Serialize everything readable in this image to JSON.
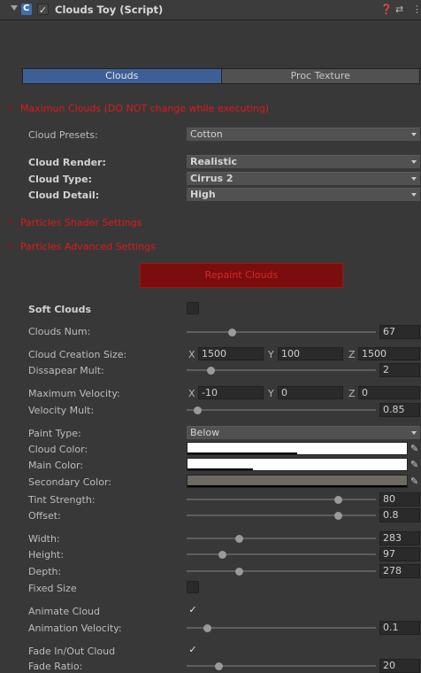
{
  "header": {
    "title": "Clouds Toy (Script)",
    "enabled_check": "✓",
    "help_icon": "help-icon",
    "settings_icon": "sliders-icon",
    "menu_icon": "more-vert-icon"
  },
  "tabs": [
    {
      "label": "Clouds",
      "active": true
    },
    {
      "label": "Proc Texture",
      "active": false
    }
  ],
  "sections": {
    "max_clouds": "Maximun Clouds (DO NOT change while executing)",
    "particles_shader": "Particles Shader Settings",
    "particles_advanced": "Particles Advanced Settings"
  },
  "fields": {
    "cloud_presets": {
      "label": "Cloud Presets:",
      "value": "Cotton"
    },
    "cloud_render": {
      "label": "Cloud Render:",
      "value": "Realistic"
    },
    "cloud_type": {
      "label": "Cloud Type:",
      "value": "Cirrus 2"
    },
    "cloud_detail": {
      "label": "Cloud Detail:",
      "value": "High"
    },
    "repaint": "Repaint Clouds",
    "soft_clouds": {
      "label": "Soft Clouds",
      "checked": false
    },
    "clouds_num": {
      "label": "Clouds Num:",
      "value": "67",
      "fraction": 0.24
    },
    "cloud_creation_size": {
      "label": "Cloud Creation Size:",
      "x": "1500",
      "y": "100",
      "z": "1500"
    },
    "dissapear_mult": {
      "label": "Dissapear Mult:",
      "value": "2",
      "fraction": 0.13
    },
    "maximum_velocity": {
      "label": "Maximum Velocity:",
      "x": "-10",
      "y": "0",
      "z": "0"
    },
    "velocity_mult": {
      "label": "Velocity Mult:",
      "value": "0.85",
      "fraction": 0.06
    },
    "paint_type": {
      "label": "Paint Type:",
      "value": "Below"
    },
    "cloud_color": {
      "label": "Cloud Color:",
      "color": "#ffffff",
      "alpha": 0.5
    },
    "main_color": {
      "label": "Main Color:",
      "color": "#ffffff",
      "alpha": 0.3
    },
    "secondary_color": {
      "label": "Secondary Color:",
      "color": "#6e6a62",
      "alpha": 1.0
    },
    "tint_strength": {
      "label": "Tint Strength:",
      "value": "80",
      "fraction": 0.8
    },
    "offset": {
      "label": "Offset:",
      "value": "0.8",
      "fraction": 0.8
    },
    "width": {
      "label": "Width:",
      "value": "283",
      "fraction": 0.28
    },
    "height": {
      "label": "Height:",
      "value": "97",
      "fraction": 0.19
    },
    "depth": {
      "label": "Depth:",
      "value": "278",
      "fraction": 0.28
    },
    "fixed_size": {
      "label": "Fixed Size",
      "checked": false
    },
    "animate_cloud": {
      "label": "Animate Cloud",
      "checked": true,
      "mark": "✓"
    },
    "animation_velocity": {
      "label": "Animation Velocity:",
      "value": "0.1",
      "fraction": 0.11
    },
    "fade_cloud": {
      "label": "Fade In/Out Cloud",
      "checked": true,
      "mark": "✓"
    },
    "fade_ratio": {
      "label": "Fade Ratio:",
      "value": "20",
      "fraction": 0.17
    }
  },
  "axis": {
    "x": "X",
    "y": "Y",
    "z": "Z"
  },
  "colors": {
    "accent_tab": "#3e5f96",
    "warning_red": "#e21919",
    "repaint_bg": "#7a0d0d"
  }
}
